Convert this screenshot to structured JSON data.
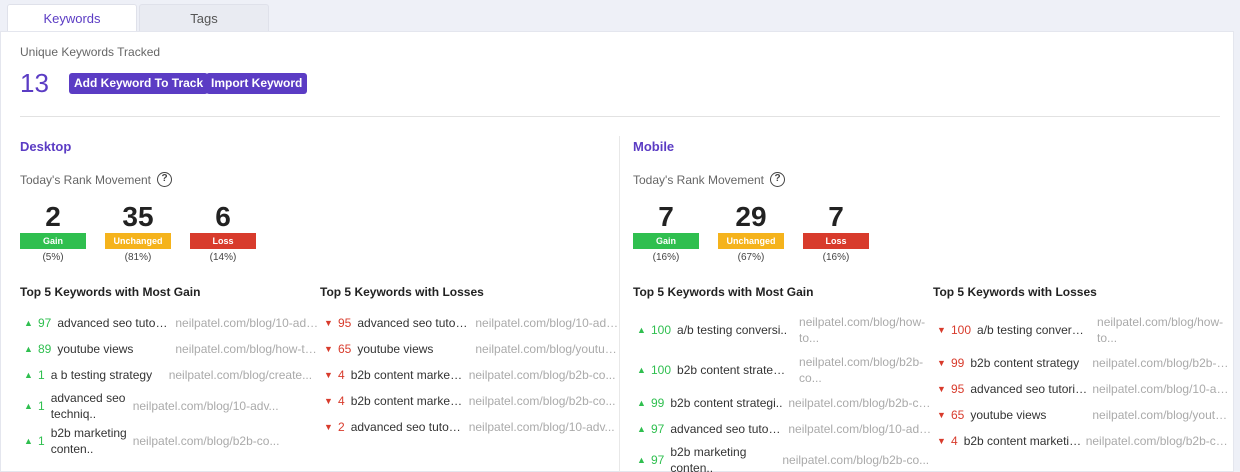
{
  "tabs": [
    {
      "label": "Keywords",
      "active": true
    },
    {
      "label": "Tags",
      "active": false
    }
  ],
  "unique": {
    "label": "Unique Keywords Tracked",
    "count": "13",
    "add_button": "Add Keyword To Track",
    "import_button": "Import Keyword"
  },
  "colors": {
    "accent": "#5b3cc4",
    "gain": "#2fbf4f",
    "unchanged": "#f5b31c",
    "loss": "#d83b2c"
  },
  "desktop": {
    "title": "Desktop",
    "rank_label": "Today's Rank Movement",
    "help": "?",
    "gain": {
      "num": "2",
      "label": "Gain",
      "pct": "(5%)"
    },
    "unchanged": {
      "num": "35",
      "label": "Unchanged",
      "pct": "(81%)"
    },
    "loss": {
      "num": "6",
      "label": "Loss",
      "pct": "(14%)"
    },
    "gain_title": "Top 5 Keywords with Most Gain",
    "loss_title": "Top 5 Keywords with Losses",
    "gains": [
      {
        "value": "97",
        "keyword": "advanced seo tutoria..",
        "url": "neilpatel.com/blog/10-adv..."
      },
      {
        "value": "89",
        "keyword": "youtube views",
        "url": "neilpatel.com/blog/how-to..."
      },
      {
        "value": "1",
        "keyword": "a b testing strategy",
        "url": "neilpatel.com/blog/create..."
      },
      {
        "value": "1",
        "keyword": "advanced seo techniq..",
        "url": "neilpatel.com/blog/10-adv..."
      },
      {
        "value": "1",
        "keyword": "b2b marketing conten..",
        "url": "neilpatel.com/blog/b2b-co..."
      }
    ],
    "losses": [
      {
        "value": "95",
        "keyword": "advanced seo tutoria..",
        "url": "neilpatel.com/blog/10-adv..."
      },
      {
        "value": "65",
        "keyword": "youtube views",
        "url": "neilpatel.com/blog/youtub..."
      },
      {
        "value": "4",
        "keyword": "b2b content marketin..",
        "url": "neilpatel.com/blog/b2b-co..."
      },
      {
        "value": "4",
        "keyword": "b2b content marketin..",
        "url": "neilpatel.com/blog/b2b-co..."
      },
      {
        "value": "2",
        "keyword": "advanced seo tutoria..",
        "url": "neilpatel.com/blog/10-adv..."
      }
    ]
  },
  "mobile": {
    "title": "Mobile",
    "rank_label": "Today's Rank Movement",
    "help": "?",
    "gain": {
      "num": "7",
      "label": "Gain",
      "pct": "(16%)"
    },
    "unchanged": {
      "num": "29",
      "label": "Unchanged",
      "pct": "(67%)"
    },
    "loss": {
      "num": "7",
      "label": "Loss",
      "pct": "(16%)"
    },
    "gain_title": "Top 5 Keywords with Most Gain",
    "loss_title": "Top 5 Keywords with Losses",
    "gains": [
      {
        "value": "100",
        "keyword": "a/b testing conversi..",
        "url": "neilpatel.com/blog/how-to..."
      },
      {
        "value": "100",
        "keyword": "b2b content strategi..",
        "url": "neilpatel.com/blog/b2b-co..."
      },
      {
        "value": "99",
        "keyword": "b2b content strategi..",
        "url": "neilpatel.com/blog/b2b-co..."
      },
      {
        "value": "97",
        "keyword": "advanced seo tutoria..",
        "url": "neilpatel.com/blog/10-adv..."
      },
      {
        "value": "97",
        "keyword": "b2b marketing conten..",
        "url": "neilpatel.com/blog/b2b-co..."
      }
    ],
    "losses": [
      {
        "value": "100",
        "keyword": "a/b testing conversi..",
        "url": "neilpatel.com/blog/how-to..."
      },
      {
        "value": "99",
        "keyword": "b2b content strategy",
        "url": "neilpatel.com/blog/b2b-co..."
      },
      {
        "value": "95",
        "keyword": "advanced seo tutoria..",
        "url": "neilpatel.com/blog/10-adv..."
      },
      {
        "value": "65",
        "keyword": "youtube views",
        "url": "neilpatel.com/blog/youtub..."
      },
      {
        "value": "4",
        "keyword": "b2b content marketin..",
        "url": "neilpatel.com/blog/b2b-co..."
      }
    ]
  }
}
